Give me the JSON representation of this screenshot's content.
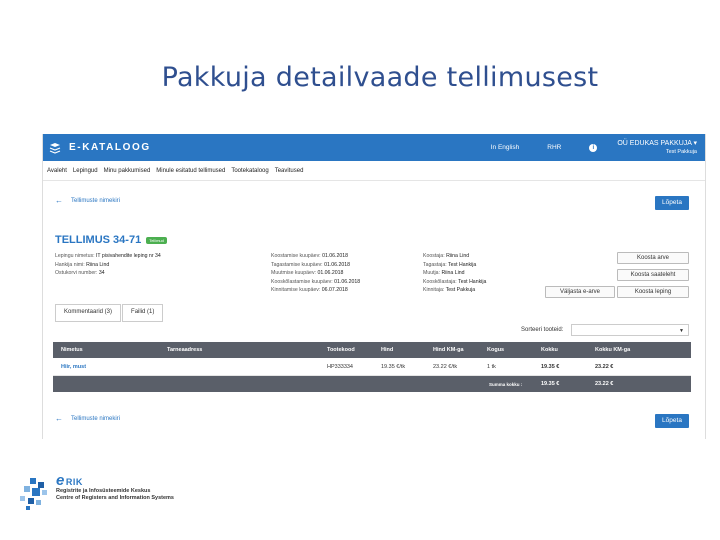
{
  "slide": {
    "title": "Pakkuja detailvaade tellimusest"
  },
  "topbar": {
    "logo_text": "E-KATALOOG",
    "lang_link": "In English",
    "rhr_link": "RHR",
    "info_icon": "i",
    "user_org": "OÜ EDUKAS PAKKUJA ▾",
    "user_name": "Test Pakkuja"
  },
  "menu": {
    "items": [
      "Avaleht",
      "Lepingud",
      "Minu pakkumised",
      "Minule esitatud tellimused",
      "Tootekataloog",
      "Teavitused"
    ]
  },
  "nav": {
    "back_label": "Tellimuste nimekiri",
    "finish_label": "Lõpeta"
  },
  "order": {
    "title": "TELLIMUS 34-71",
    "status": "Tellimud",
    "left_meta": [
      {
        "label": "Lepingu nimetus:",
        "value": "IT pisivahendite leping nr 34"
      },
      {
        "label": "Hankija nimi:",
        "value": "Riina Lind"
      },
      {
        "label": "Ostukorvi number:",
        "value": "34"
      }
    ],
    "mid_meta": [
      {
        "label": "Koostamise kuupäev:",
        "value": "01.06.2018"
      },
      {
        "label": "Tagastamise kuupäev:",
        "value": "01.06.2018"
      },
      {
        "label": "Muutmise kuupäev:",
        "value": "01.06.2018"
      },
      {
        "label": "Kooskõlastamise kuupäev:",
        "value": "01.06.2018"
      },
      {
        "label": "Kinnitamise kuupäev:",
        "value": "06.07.2018"
      }
    ],
    "right_meta": [
      {
        "label": "Koostaja:",
        "value": "Riina Lind"
      },
      {
        "label": "Tagastaja:",
        "value": "Test Hankija"
      },
      {
        "label": "Muutja:",
        "value": "Riina Lind"
      },
      {
        "label": "Kooskõlastaja:",
        "value": "Test Hankija"
      },
      {
        "label": "Kinnitaja:",
        "value": "Test Pakkuja"
      }
    ]
  },
  "actions": {
    "create_invoice": "Koosta arve",
    "create_delivery_note": "Koosta saateleht",
    "export_einvoice": "Väljasta e-arve",
    "create_contract": "Koosta leping"
  },
  "tabs": [
    {
      "label": "Kommentaarid (3)"
    },
    {
      "label": "Failid (1)"
    }
  ],
  "sort": {
    "label": "Sorteeri tooteid:",
    "value": ""
  },
  "table": {
    "headers": [
      "Nimetus",
      "Tarneaadress",
      "Tootekood",
      "Hind",
      "Hind KM-ga",
      "Kogus",
      "Kokku",
      "Kokku KM-ga"
    ],
    "rows": [
      {
        "name": "Hiir, must",
        "address": "",
        "code": "HP333334",
        "price": "19.35 €/tk",
        "price_vat": "23.22 €/tk",
        "qty": "1 tk",
        "total": "19.35 €",
        "total_vat": "23.22 €"
      }
    ],
    "sum": {
      "label": "Summa kokku :",
      "total": "19.35 €",
      "total_vat": "23.22 €"
    }
  },
  "footer": {
    "logo_e": "e",
    "logo_rik": "RIK",
    "line1": "Registrite ja Infosüsteemide Keskus",
    "line2": "Centre of Registers and Information Systems"
  }
}
